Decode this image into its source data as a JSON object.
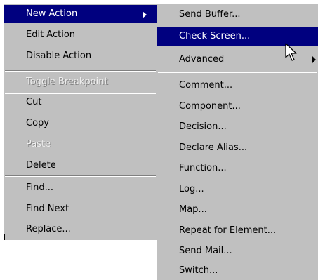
{
  "main_menu": {
    "items": [
      {
        "label": "New Action"
      },
      {
        "label": "Edit Action"
      },
      {
        "label": "Disable Action"
      },
      {
        "label": "Toggle Breakpoint"
      },
      {
        "label": "Cut"
      },
      {
        "label": "Copy"
      },
      {
        "label": "Paste"
      },
      {
        "label": "Delete"
      },
      {
        "label": "Find..."
      },
      {
        "label": "Find Next"
      },
      {
        "label": "Replace..."
      }
    ]
  },
  "submenu": {
    "items": [
      {
        "label": "Send Buffer..."
      },
      {
        "label": "Check Screen..."
      },
      {
        "label": "Advanced"
      },
      {
        "label": "Comment..."
      },
      {
        "label": "Component..."
      },
      {
        "label": "Decision..."
      },
      {
        "label": "Declare Alias..."
      },
      {
        "label": "Function..."
      },
      {
        "label": "Log..."
      },
      {
        "label": "Map..."
      },
      {
        "label": "Repeat for Element..."
      },
      {
        "label": "Send Mail..."
      },
      {
        "label": "Switch..."
      }
    ]
  },
  "colors": {
    "menu_bg": "#c0c0c0",
    "highlight_bg": "#00007f",
    "highlight_text": "#ffffff",
    "disabled_text": "#eeeeee",
    "separator": "#808080"
  },
  "icons": [
    "submenu-arrow-icon",
    "mouse-cursor-icon"
  ]
}
